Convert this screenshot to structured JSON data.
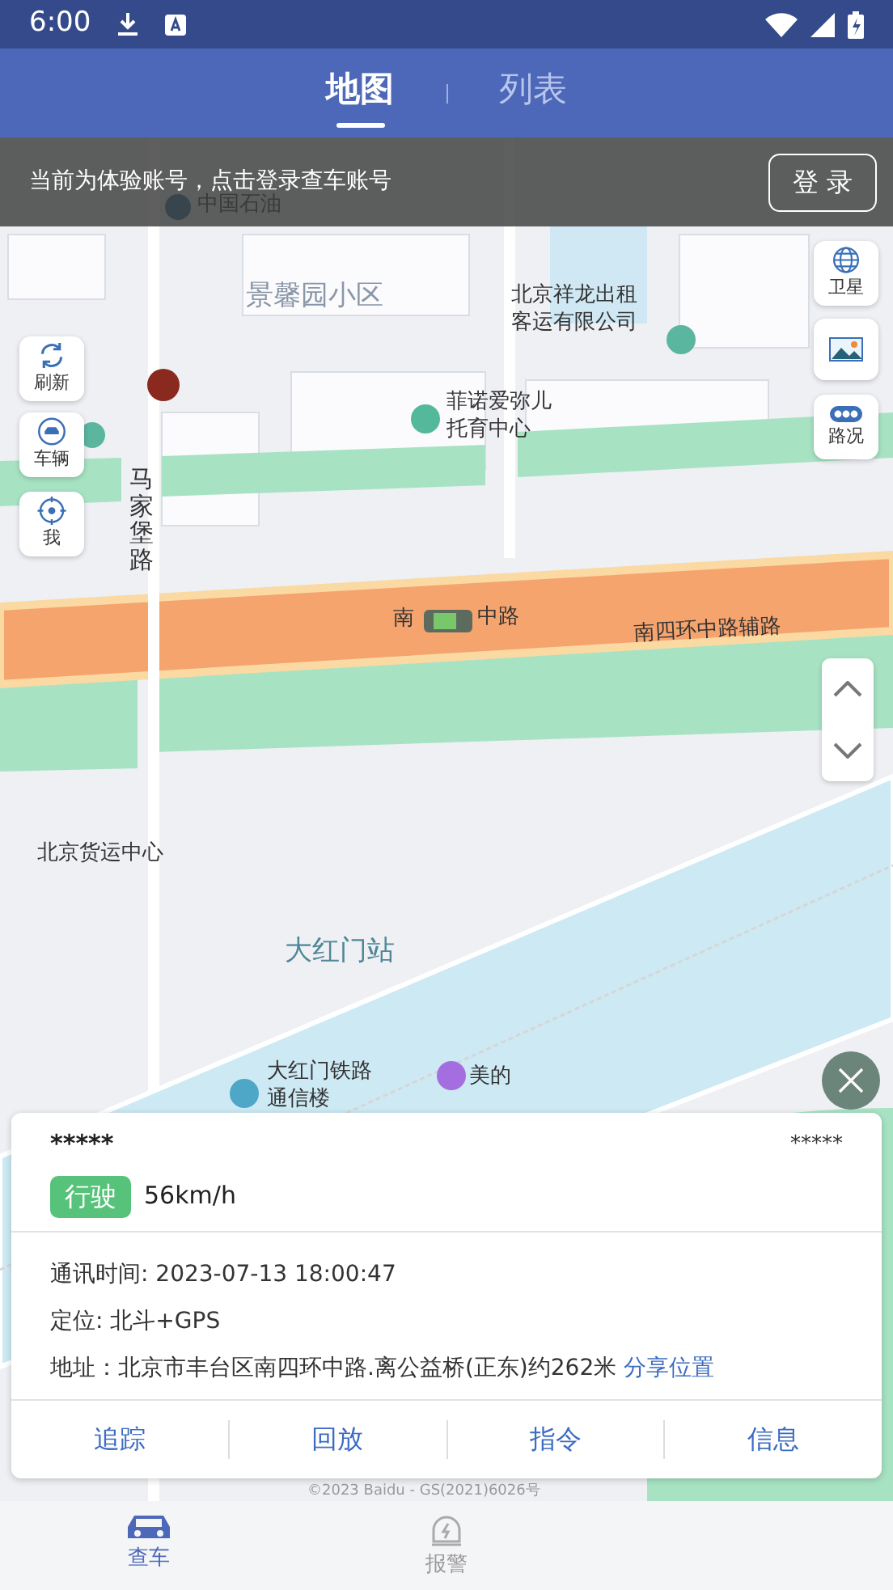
{
  "status_bar": {
    "time": "6:00"
  },
  "tabs": [
    {
      "label": "地图",
      "selected": true
    },
    {
      "label": "列表",
      "selected": false
    }
  ],
  "banner": {
    "text": "当前为体验账号，点击登录查车账号",
    "button": "登 录"
  },
  "map": {
    "labels": [
      "中国石油",
      "景馨园小区",
      "北京祥龙出租客运有限公司",
      "菲诺爱弥儿托育中心",
      "马家堡路",
      "南",
      "中路",
      "南四环中路辅路",
      "北京货运中心",
      "大红门站",
      "大红门铁路通信楼",
      "美的"
    ],
    "copyright": "©2023 Baidu - GS(2021)6026号"
  },
  "left_controls": [
    {
      "kind": "refresh",
      "label": "刷新"
    },
    {
      "kind": "vehicle",
      "label": "车辆"
    },
    {
      "kind": "locate",
      "label": "我"
    }
  ],
  "right_controls": [
    {
      "kind": "satellite",
      "label": "卫星"
    },
    {
      "kind": "image"
    },
    {
      "kind": "traffic",
      "label": "路况"
    }
  ],
  "vehicle_card": {
    "plate": "*****",
    "device": "*****",
    "status": "行驶",
    "speed": "56km/h",
    "comm_time": "通讯时间: 2023-07-13 18:00:47",
    "positioning": "定位: 北斗+GPS",
    "address": "地址：北京市丰台区南四环中路.离公益桥(正东)约262米",
    "share_link": "分享位置",
    "actions": [
      "追踪",
      "回放",
      "指令",
      "信息"
    ]
  },
  "bottom_nav": [
    {
      "label": "查车",
      "selected": true,
      "kind": "car"
    },
    {
      "label": "报警",
      "selected": false,
      "kind": "alarm"
    }
  ]
}
